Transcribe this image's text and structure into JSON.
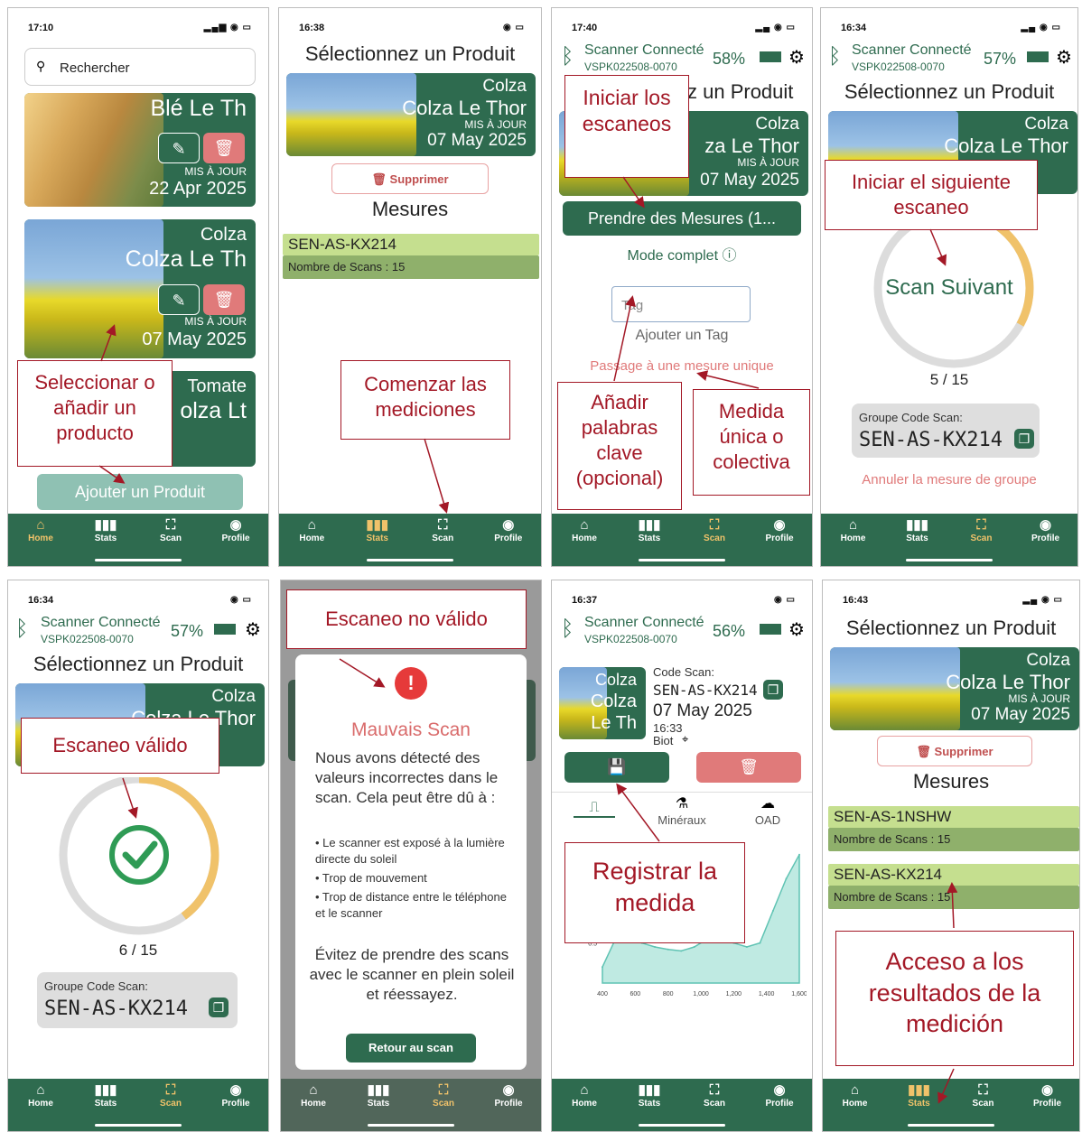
{
  "nav": {
    "home": "Home",
    "stats": "Stats",
    "scan": "Scan",
    "profile": "Profile"
  },
  "screens": {
    "s1": {
      "time": "17:10",
      "search_placeholder": "Rechercher",
      "product1_title": "Blé Le Th",
      "product_updated_label": "MIS À JOUR",
      "product1_date": "22 Apr 2025",
      "product2_type": "Colza",
      "product2_title": "Colza Le Th",
      "product2_date": "07 May 2025",
      "product3_type": "Tomate",
      "product3_title": "olza Lt",
      "add_product_label": "Ajouter un Produit",
      "annotation": "Seleccionar o añadir un producto"
    },
    "s2": {
      "time": "16:38",
      "title": "Sélectionnez un Produit",
      "product_type": "Colza",
      "product_name": "Colza Le Thor",
      "updated_label": "MIS À JOUR",
      "product_date": "07 May 2025",
      "delete_label": "Supprimer",
      "measures_heading": "Mesures",
      "group_code": "SEN-AS-KX214",
      "scan_count": "Nombre de Scans : 15",
      "annotation": "Comenzar las mediciones"
    },
    "s3": {
      "time": "17:40",
      "scanner_status": "Scanner Connecté",
      "scanner_id": "VSPK022508-0070",
      "battery": "58%",
      "title_fragment": "z un Produit",
      "product_type": "Colza",
      "product_name": "za Le Thor",
      "updated_label": "MIS À JOUR",
      "product_date": "07 May 2025",
      "take_measures_label": "Prendre des Mesures (1...",
      "mode_label": "Mode complet",
      "tag_placeholder": "Tag",
      "add_tag_label": "Ajouter un Tag",
      "single_measure_link": "Passage à une mesure unique",
      "annotation_start": "Iniciar los escaneos",
      "annotation_keywords": "Añadir palabras clave (opcional)",
      "annotation_single": "Medida única o colectiva"
    },
    "s4": {
      "time": "16:34",
      "scanner_status": "Scanner Connecté",
      "scanner_id": "VSPK022508-0070",
      "battery": "57%",
      "title": "Sélectionnez un Produit",
      "product_type": "Colza",
      "product_name": "Colza Le Thor",
      "next_scan_label": "Scan Suivant",
      "progress_text": "5 / 15",
      "progress": 0.33,
      "group_label": "Groupe Code Scan:",
      "group_code": "SEN-AS-KX214",
      "cancel_label": "Annuler la mesure de groupe",
      "annotation": "Iniciar el siguiente escaneo"
    },
    "s5": {
      "time": "16:34",
      "scanner_status": "Scanner Connecté",
      "scanner_id": "VSPK022508-0070",
      "battery": "57%",
      "title": "Sélectionnez un Produit",
      "product_type": "Colza",
      "product_name": "Colza Le Thor",
      "progress_text": "6 / 15",
      "progress": 0.4,
      "group_label": "Groupe Code Scan:",
      "group_code": "SEN-AS-KX214",
      "annotation": "Escaneo válido"
    },
    "s6": {
      "modal_title": "Mauvais Scan",
      "modal_intro": "Nous avons détecté des valeurs incorrectes dans le scan. Cela peut être dû à :",
      "reason1": "• Le scanner est exposé à la lumière directe du soleil",
      "reason2": "• Trop de mouvement",
      "reason3": "• Trop de distance entre le téléphone et le scanner",
      "modal_advice": "Évitez de prendre des scans avec le scanner en plein soleil et réessayez.",
      "retry_label": "Retour au scan",
      "annotation": "Escaneo no válido"
    },
    "s7": {
      "time": "16:37",
      "scanner_status": "Scanner Connecté",
      "scanner_id": "VSPK022508-0070",
      "battery": "56%",
      "thumb_type": "Colza",
      "thumb_name": "Colza Le Th",
      "code_label": "Code Scan:",
      "code": "SEN-AS-KX214",
      "date": "07 May 2025",
      "time_of_scan": "16:33",
      "location": "Biot",
      "tab_minerals": "Minéraux",
      "tab_oad": "OAD",
      "annotation": "Registrar la medida",
      "chart_ticks_y": [
        "1.0",
        "0.5"
      ],
      "chart_ticks_x": [
        "400",
        "600",
        "800",
        "1,000",
        "1,200",
        "1,400",
        "1,600"
      ]
    },
    "s8": {
      "time": "16:43",
      "title": "Sélectionnez un Produit",
      "product_type": "Colza",
      "product_name": "Colza Le Thor",
      "updated_label": "MIS À JOUR",
      "product_date": "07 May 2025",
      "delete_label": "Supprimer",
      "measures_heading": "Mesures",
      "group1_code": "SEN-AS-1NSHW",
      "group1_count": "Nombre de Scans : 15",
      "group2_code": "SEN-AS-KX214",
      "group2_count": "Nombre de Scans : 15",
      "annotation": "Acceso a los resultados de la medición"
    }
  },
  "chart_data": {
    "type": "area",
    "x": [
      400,
      480,
      560,
      640,
      720,
      800,
      880,
      960,
      1040,
      1120,
      1200,
      1280,
      1360,
      1440,
      1520,
      1600
    ],
    "values": [
      0.2,
      0.55,
      0.6,
      0.5,
      0.45,
      0.42,
      0.4,
      0.45,
      0.55,
      0.58,
      0.5,
      0.45,
      0.5,
      0.9,
      1.3,
      1.6
    ],
    "xlim": [
      400,
      1600
    ],
    "ylim": [
      0,
      1.8
    ]
  },
  "colors": {
    "primary": "#2e6b4f",
    "accent": "#f0c26a",
    "chip": "#c5df8f",
    "danger": "#a31826",
    "delete": "#e07a7a"
  }
}
